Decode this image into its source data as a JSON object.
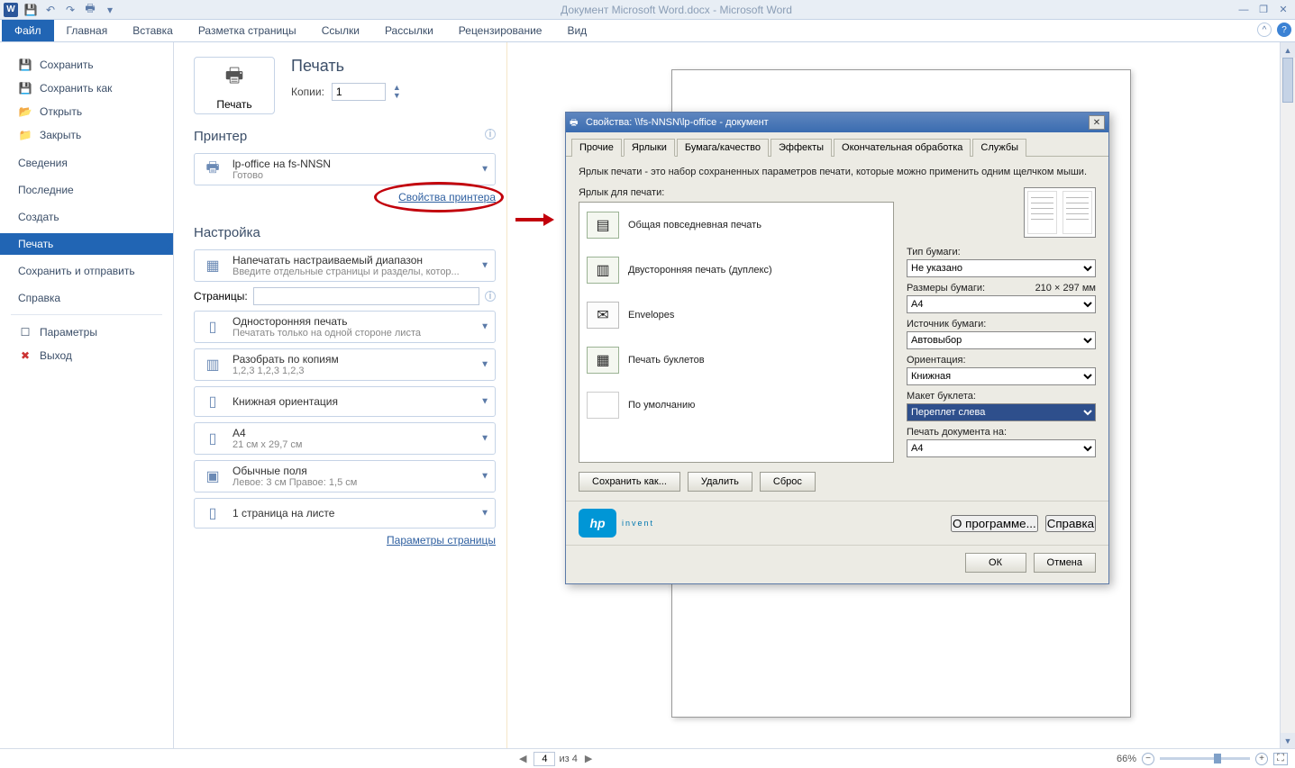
{
  "titlebar": {
    "title": "Документ Microsoft Word.docx - Microsoft Word"
  },
  "ribbon": {
    "tabs": [
      "Файл",
      "Главная",
      "Вставка",
      "Разметка страницы",
      "Ссылки",
      "Рассылки",
      "Рецензирование",
      "Вид"
    ]
  },
  "sidebar": {
    "save": "Сохранить",
    "saveas": "Сохранить как",
    "open": "Открыть",
    "close": "Закрыть",
    "info": "Сведения",
    "recent": "Последние",
    "new": "Создать",
    "print": "Печать",
    "send": "Сохранить и отправить",
    "help": "Справка",
    "options": "Параметры",
    "exit": "Выход"
  },
  "mid": {
    "print_h": "Печать",
    "print_btn": "Печать",
    "copies_lbl": "Копии:",
    "copies_val": "1",
    "printer_h": "Принтер",
    "printer_name": "lp-office на fs-NNSN",
    "printer_status": "Готово",
    "printer_props": "Свойства принтера",
    "settings_h": "Настройка",
    "range_t": "Напечатать настраиваемый диапазон",
    "range_s": "Введите отдельные страницы и разделы, котор...",
    "pages_lbl": "Страницы:",
    "side_t": "Односторонняя печать",
    "side_s": "Печатать только на одной стороне листа",
    "collate_t": "Разобрать по копиям",
    "collate_s": "1,2,3    1,2,3    1,2,3",
    "orient_t": "Книжная ориентация",
    "paper_t": "A4",
    "paper_s": "21 см x 29,7 см",
    "margin_t": "Обычные поля",
    "margin_s": "Левое:  3 см    Правое:  1,5 см",
    "ppp_t": "1 страница на листе",
    "page_setup": "Параметры страницы"
  },
  "dialog": {
    "title": "Свойства: \\\\fs-NNSN\\lp-office - документ",
    "tabs": [
      "Прочие",
      "Ярлыки",
      "Бумага/качество",
      "Эффекты",
      "Окончательная обработка",
      "Службы"
    ],
    "desc": "Ярлык печати - это набор сохраненных параметров печати, которые можно применить одним щелчком мыши.",
    "list_lbl": "Ярлык для печати:",
    "items": [
      "Общая повседневная печать",
      "Двусторонняя печать (дуплекс)",
      "Envelopes",
      "Печать буклетов",
      "По умолчанию"
    ],
    "papertype_lbl": "Тип бумаги:",
    "papertype_val": "Не указано",
    "papersize_lbl": "Размеры бумаги:",
    "papersize_info": "210 × 297 мм",
    "papersize_val": "A4",
    "papersrc_lbl": "Источник бумаги:",
    "papersrc_val": "Автовыбор",
    "orient_lbl": "Ориентация:",
    "orient_val": "Книжная",
    "booklet_lbl": "Макет буклета:",
    "booklet_val": "Переплет слева",
    "printon_lbl": "Печать документа на:",
    "printon_val": "A4",
    "btn_saveas": "Сохранить как...",
    "btn_delete": "Удалить",
    "btn_reset": "Сброс",
    "btn_about": "О программе...",
    "btn_help": "Справка",
    "btn_ok": "ОК",
    "btn_cancel": "Отмена",
    "hp_sub": "invent"
  },
  "status": {
    "page_cur": "4",
    "page_of": "из 4",
    "zoom": "66%"
  }
}
